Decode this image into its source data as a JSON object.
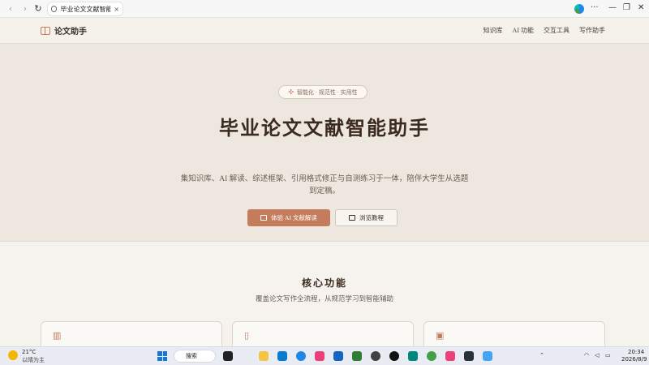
{
  "browser": {
    "tab_title": "毕业论文文献智能助手",
    "back": "‹",
    "forward": "›",
    "reload": "↻",
    "close_tab": "×",
    "more": "···",
    "minimize": "—",
    "restore": "❐",
    "close_window": "✕"
  },
  "header": {
    "brand": "论文助手",
    "menu": [
      "知识库",
      "AI 功能",
      "交互工具",
      "写作助手"
    ]
  },
  "hero": {
    "pill": "智能化 · 规范性 · 实用性",
    "title": "毕业论文文献智能助手",
    "description": "集知识库、AI 解读、综述框架、引用格式修正与自测练习于一体，陪伴大学生从选题到定稿。",
    "primary_button": "体验 AI 文献解读",
    "secondary_button": "浏览教程"
  },
  "features": {
    "title": "核心功能",
    "subtitle": "覆盖论文写作全流程，从规范学习到智能辅助",
    "card_icons": [
      "books-icon",
      "book-icon",
      "robot-icon"
    ]
  },
  "taskbar": {
    "temperature": "21°C",
    "weather": "以晴为主",
    "search": "搜索",
    "time": "20:34",
    "date": "2026/8/9"
  },
  "colors": {
    "accent": "#c57c5c",
    "hero_bg": "#ede7df",
    "text_dark": "#3b2a1f"
  }
}
